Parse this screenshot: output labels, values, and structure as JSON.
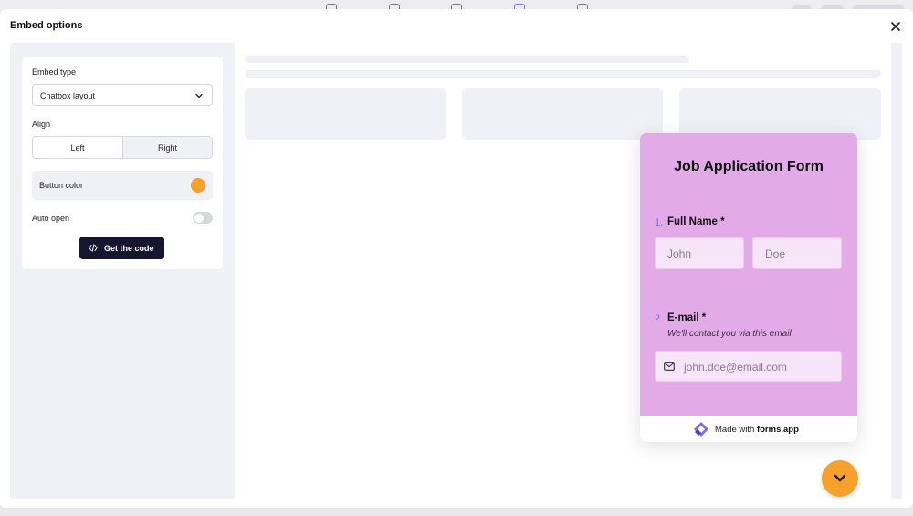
{
  "modal": {
    "title": "Embed options"
  },
  "settings": {
    "embed_type_label": "Embed type",
    "embed_type_value": "Chatbox layout",
    "align_label": "Align",
    "align_options": [
      "Left",
      "Right"
    ],
    "align_selected": "Right",
    "button_color_label": "Button color",
    "button_color": "#f7a02a",
    "auto_open_label": "Auto open",
    "auto_open": false,
    "get_code_label": "Get the code"
  },
  "form": {
    "title": "Job Application Form",
    "questions": [
      {
        "number": "1.",
        "label": "Full Name *",
        "placeholders": [
          "John",
          "Doe"
        ]
      },
      {
        "number": "2.",
        "label": "E-mail *",
        "hint": "We'll contact you via this email.",
        "placeholder": "john.doe@email.com"
      }
    ],
    "footer_made": "Made with",
    "footer_brand": "forms.app",
    "background_color": "#e2abe8"
  },
  "colors": {
    "accent_dark": "#161631",
    "orange": "#f7a02a",
    "question_number": "#7d6cf0"
  }
}
